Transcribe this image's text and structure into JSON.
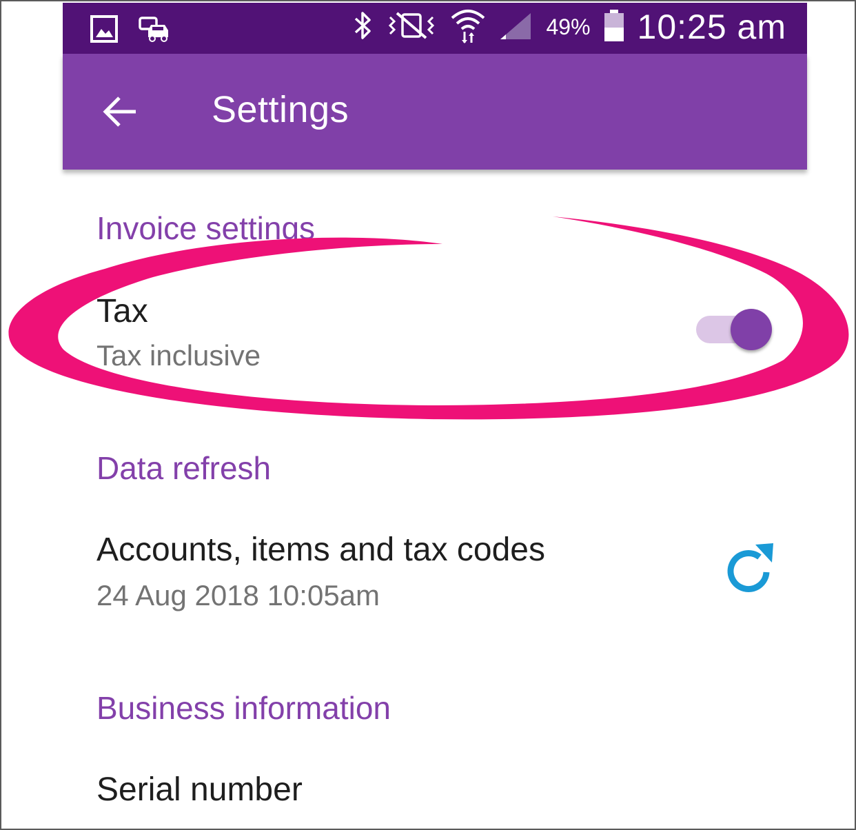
{
  "status_bar": {
    "icons_left": [
      "gallery-icon",
      "car-mode-icon"
    ],
    "icons_right": [
      "bluetooth-icon",
      "mute-vibrate-icon",
      "wifi-icon",
      "signal-icon",
      "battery-icon"
    ],
    "battery_percent": "49%",
    "time": "10:25 am"
  },
  "app_bar": {
    "title": "Settings",
    "back_icon": "arrow-back-icon",
    "color": "#8040a8"
  },
  "sections": {
    "invoice": {
      "header": "Invoice settings",
      "tax": {
        "title": "Tax",
        "subtitle": "Tax inclusive",
        "enabled": true
      }
    },
    "data_refresh": {
      "header": "Data refresh",
      "item": {
        "title": "Accounts, items and tax codes",
        "subtitle": "24 Aug 2018 10:05am",
        "icon": "refresh-icon"
      }
    },
    "business": {
      "header": "Business information",
      "item": {
        "title": "Serial number"
      }
    }
  },
  "colors": {
    "status_bar": "#511276",
    "accent": "#8340aa",
    "annotation": "#ee1177",
    "refresh_icon": "#1a9ad6"
  }
}
